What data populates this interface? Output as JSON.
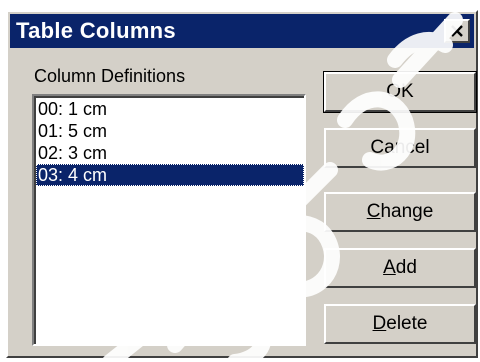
{
  "dialog": {
    "title": "Table Columns",
    "close_icon": "close-icon"
  },
  "group": {
    "label": "Column Definitions"
  },
  "list": {
    "items": [
      {
        "label": "00: 1 cm",
        "selected": false
      },
      {
        "label": "01: 5 cm",
        "selected": false
      },
      {
        "label": "02: 3 cm",
        "selected": false
      },
      {
        "label": "03: 4 cm",
        "selected": true
      }
    ]
  },
  "buttons": {
    "ok": "OK",
    "cancel": "Cancel",
    "change_mnemonic": "C",
    "change_rest": "hange",
    "add_mnemonic": "A",
    "add_rest": "dd",
    "delete_mnemonic": "D",
    "delete_rest": "elete"
  },
  "colors": {
    "titlebar": "#0a246a",
    "face": "#d4d0c8",
    "selection": "#0a246a",
    "watermark": "#000000"
  }
}
